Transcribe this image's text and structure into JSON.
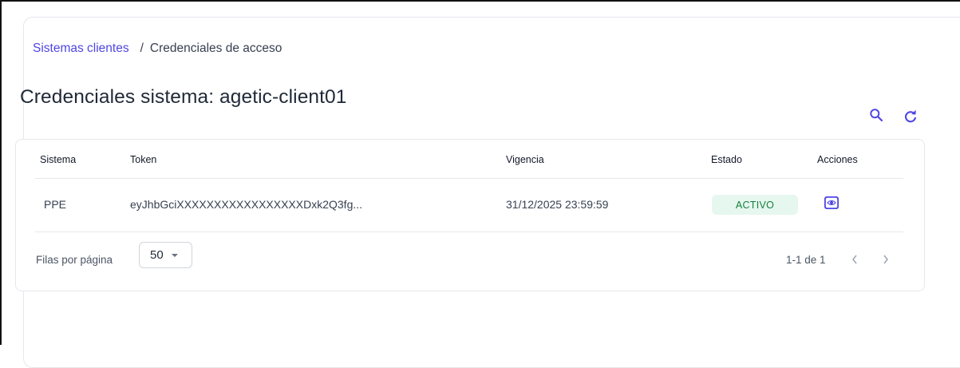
{
  "breadcrumb": {
    "parent": "Sistemas clientes",
    "separator": "/",
    "current": "Credenciales de acceso"
  },
  "page": {
    "title": "Credenciales sistema: agetic-client01"
  },
  "toolbar": {
    "search_icon": "search-icon",
    "refresh_icon": "refresh-icon"
  },
  "table": {
    "columns": [
      "Sistema",
      "Token",
      "Vigencia",
      "Estado",
      "Acciones"
    ],
    "rows": [
      {
        "sistema": "PPE",
        "token": "eyJhbGciXXXXXXXXXXXXXXXXXDxk2Q3fg...",
        "vigencia": "31/12/2025 23:59:59",
        "estado": "ACTIVO",
        "accion_icon": "eye-icon"
      }
    ]
  },
  "pagination": {
    "rows_per_page_label": "Filas por página",
    "rows_per_page_value": "50",
    "range": "1-1 de 1"
  },
  "colors": {
    "accent": "#4f46e5",
    "status_active_bg": "#e6f7ef",
    "status_active_text": "#15803d"
  }
}
